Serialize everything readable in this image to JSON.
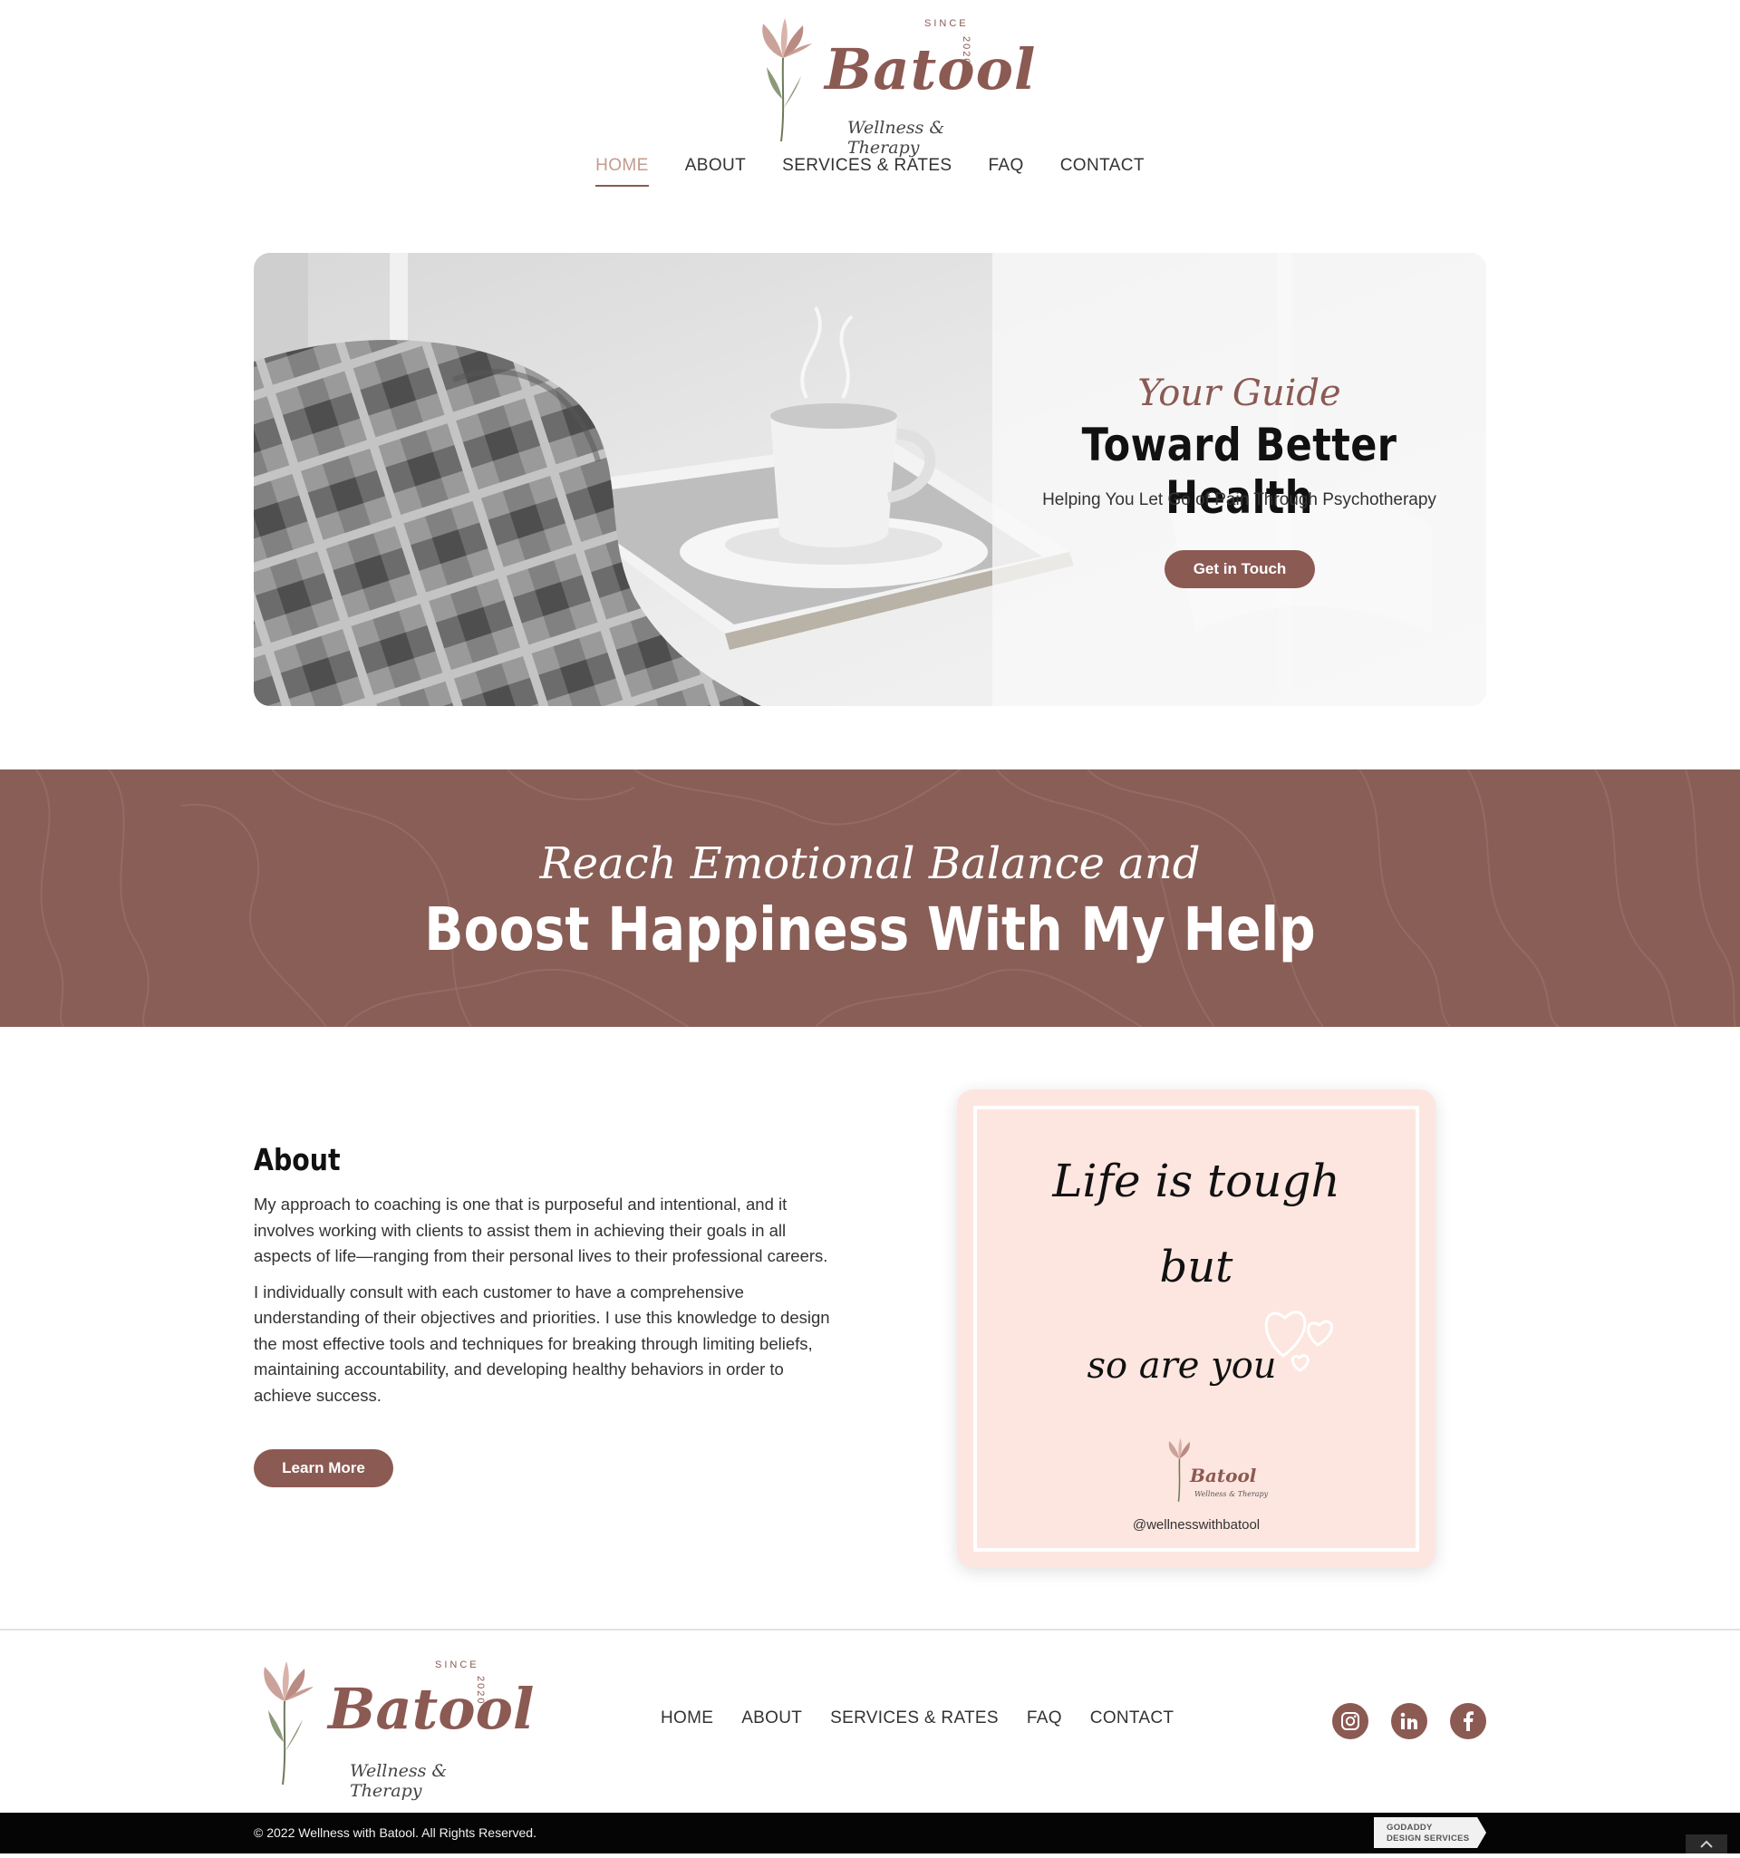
{
  "brand": {
    "name": "Batool",
    "tagline": "Wellness & Therapy",
    "since": "SINCE",
    "year": "2020"
  },
  "nav": {
    "items": [
      {
        "label": "HOME",
        "active": true
      },
      {
        "label": "ABOUT"
      },
      {
        "label": "SERVICES & RATES"
      },
      {
        "label": "FAQ"
      },
      {
        "label": "CONTACT"
      }
    ]
  },
  "hero": {
    "script": "Your Guide",
    "heading": "Toward Better Health",
    "subheading": "Helping You Let Go of Pain Through Psychotherapy",
    "cta": "Get in Touch"
  },
  "banner": {
    "script": "Reach Emotional Balance and",
    "heading": "Boost Happiness With My Help"
  },
  "about": {
    "title": "About",
    "paragraphs": [
      "My approach to coaching is one that is purposeful and intentional, and it involves working with clients to assist them in achieving their goals in all aspects of life—ranging from their personal lives to their professional careers.",
      "I individually consult with each customer to have a comprehensive understanding of their objectives and priorities. I use this knowledge to design the most effective tools and techniques for breaking through limiting beliefs, maintaining accountability, and developing healthy behaviors in order to achieve success."
    ],
    "cta": "Learn More"
  },
  "quote_card": {
    "line1": "Life is tough",
    "line2": "but",
    "line3": "so are you",
    "handle": "@wellnesswithbatool"
  },
  "footer": {
    "nav": [
      "HOME",
      "ABOUT",
      "SERVICES & RATES",
      "FAQ",
      "CONTACT"
    ],
    "social": [
      "instagram-icon",
      "linkedin-icon",
      "facebook-icon"
    ],
    "copyright": "© 2022 Wellness with Batool. All Rights Reserved.",
    "badge_line1": "GODADDY",
    "badge_line2": "DESIGN SERVICES"
  },
  "colors": {
    "brand": "#8b5a53",
    "accent_light": "#c49a8e",
    "card_bg": "#fde6df",
    "footer_bar": "#050505"
  }
}
